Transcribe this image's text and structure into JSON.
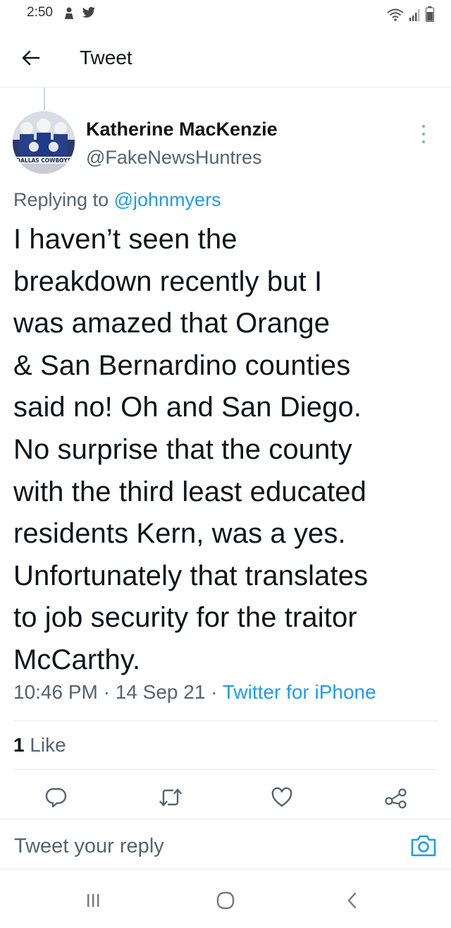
{
  "status_bar": {
    "time": "2:50"
  },
  "header": {
    "title": "Tweet"
  },
  "tweet": {
    "author_name": "Katherine MacKenzie",
    "author_handle": "@FakeNewsHuntres",
    "avatar_caption": "DALLAS COWBOYS",
    "replying_prefix": "Replying to",
    "replying_to": "@johnmyers",
    "lines": [
      "I haven’t seen the",
      "breakdown recently but I",
      "was amazed that Orange",
      "& San Bernardino counties",
      "said no! Oh and San Diego.",
      "No surprise that the county",
      "with the third least educated",
      "residents Kern, was a yes.",
      "Unfortunately that translates",
      "to job security for the traitor",
      "McCarthy."
    ],
    "time": "10:46 PM",
    "date": "14 Sep 21",
    "separator": "·",
    "source": "Twitter for iPhone",
    "like_count": "1",
    "like_label": "Like"
  },
  "actions": {
    "icons": [
      "reply-icon",
      "retweet-icon",
      "like-icon",
      "share-icon"
    ]
  },
  "reply_bar": {
    "placeholder": "Tweet your reply"
  },
  "nav": {
    "icons": [
      "recents-icon",
      "home-icon",
      "back-icon"
    ]
  },
  "colors": {
    "text": "#0f1419",
    "secondary": "#536471",
    "accent": "#1d9bf0",
    "divider": "#e6ecf0"
  }
}
